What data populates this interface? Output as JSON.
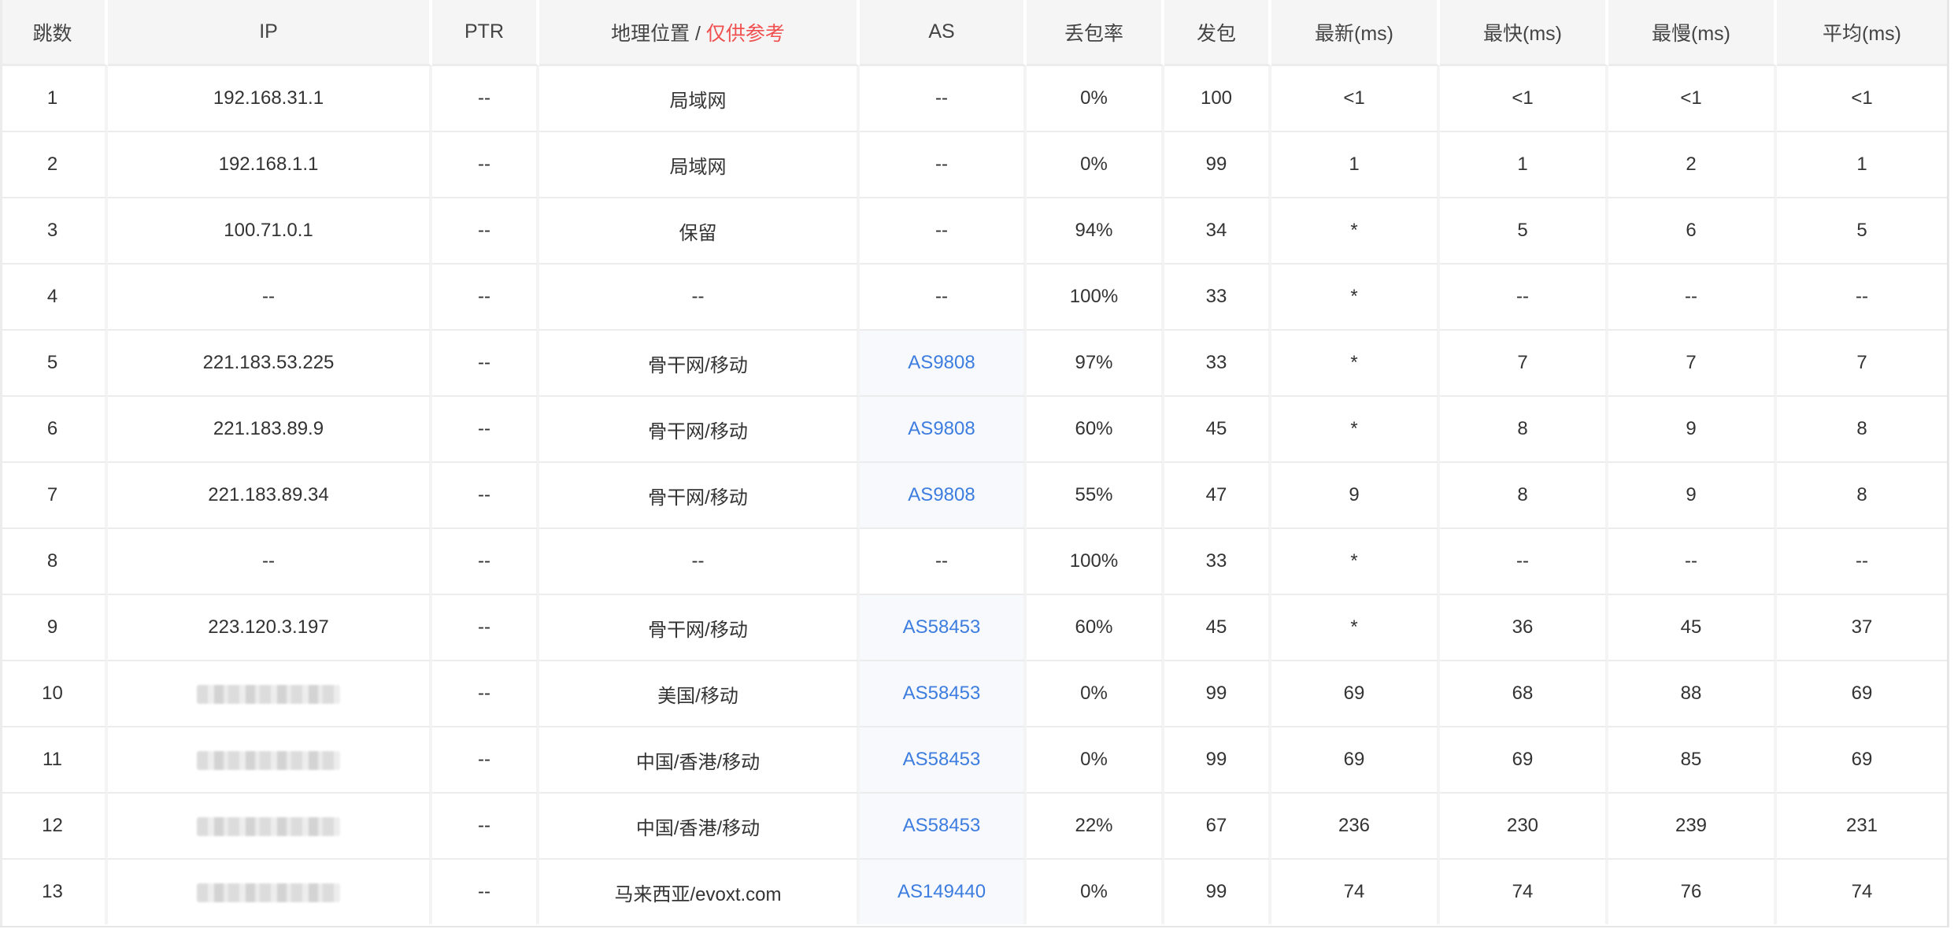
{
  "table": {
    "headers": {
      "hop": "跳数",
      "ip": "IP",
      "ptr": "PTR",
      "geo": "地理位置",
      "geo_sep": " / ",
      "geo_note": "仅供参考",
      "as": "AS",
      "loss": "丢包率",
      "sent": "发包",
      "last": "最新(ms)",
      "best": "最快(ms)",
      "worst": "最慢(ms)",
      "avg": "平均(ms)"
    },
    "colors": {
      "geo_note": "#f05050",
      "as_link": "#3d7de0"
    },
    "rows": [
      {
        "hop": "1",
        "ip": "192.168.31.1",
        "ip_masked": false,
        "ptr": "--",
        "geo": "局域网",
        "as": "--",
        "as_link": false,
        "loss": "0%",
        "sent": "100",
        "last": "<1",
        "best": "<1",
        "worst": "<1",
        "avg": "<1"
      },
      {
        "hop": "2",
        "ip": "192.168.1.1",
        "ip_masked": false,
        "ptr": "--",
        "geo": "局域网",
        "as": "--",
        "as_link": false,
        "loss": "0%",
        "sent": "99",
        "last": "1",
        "best": "1",
        "worst": "2",
        "avg": "1"
      },
      {
        "hop": "3",
        "ip": "100.71.0.1",
        "ip_masked": false,
        "ptr": "--",
        "geo": "保留",
        "as": "--",
        "as_link": false,
        "loss": "94%",
        "sent": "34",
        "last": "*",
        "best": "5",
        "worst": "6",
        "avg": "5"
      },
      {
        "hop": "4",
        "ip": "--",
        "ip_masked": false,
        "ptr": "--",
        "geo": "--",
        "as": "--",
        "as_link": false,
        "loss": "100%",
        "sent": "33",
        "last": "*",
        "best": "--",
        "worst": "--",
        "avg": "--"
      },
      {
        "hop": "5",
        "ip": "221.183.53.225",
        "ip_masked": false,
        "ptr": "--",
        "geo": "骨干网/移动",
        "as": "AS9808",
        "as_link": true,
        "loss": "97%",
        "sent": "33",
        "last": "*",
        "best": "7",
        "worst": "7",
        "avg": "7"
      },
      {
        "hop": "6",
        "ip": "221.183.89.9",
        "ip_masked": false,
        "ptr": "--",
        "geo": "骨干网/移动",
        "as": "AS9808",
        "as_link": true,
        "loss": "60%",
        "sent": "45",
        "last": "*",
        "best": "8",
        "worst": "9",
        "avg": "8"
      },
      {
        "hop": "7",
        "ip": "221.183.89.34",
        "ip_masked": false,
        "ptr": "--",
        "geo": "骨干网/移动",
        "as": "AS9808",
        "as_link": true,
        "loss": "55%",
        "sent": "47",
        "last": "9",
        "best": "8",
        "worst": "9",
        "avg": "8"
      },
      {
        "hop": "8",
        "ip": "--",
        "ip_masked": false,
        "ptr": "--",
        "geo": "--",
        "as": "--",
        "as_link": false,
        "loss": "100%",
        "sent": "33",
        "last": "*",
        "best": "--",
        "worst": "--",
        "avg": "--"
      },
      {
        "hop": "9",
        "ip": "223.120.3.197",
        "ip_masked": false,
        "ptr": "--",
        "geo": "骨干网/移动",
        "as": "AS58453",
        "as_link": true,
        "loss": "60%",
        "sent": "45",
        "last": "*",
        "best": "36",
        "worst": "45",
        "avg": "37"
      },
      {
        "hop": "10",
        "ip": "",
        "ip_masked": true,
        "ptr": "--",
        "geo": "美国/移动",
        "as": "AS58453",
        "as_link": true,
        "loss": "0%",
        "sent": "99",
        "last": "69",
        "best": "68",
        "worst": "88",
        "avg": "69"
      },
      {
        "hop": "11",
        "ip": "",
        "ip_masked": true,
        "ptr": "--",
        "geo": "中国/香港/移动",
        "as": "AS58453",
        "as_link": true,
        "loss": "0%",
        "sent": "99",
        "last": "69",
        "best": "69",
        "worst": "85",
        "avg": "69"
      },
      {
        "hop": "12",
        "ip": "",
        "ip_masked": true,
        "ptr": "--",
        "geo": "中国/香港/移动",
        "as": "AS58453",
        "as_link": true,
        "loss": "22%",
        "sent": "67",
        "last": "236",
        "best": "230",
        "worst": "239",
        "avg": "231"
      },
      {
        "hop": "13",
        "ip": "",
        "ip_masked": true,
        "ptr": "--",
        "geo": "马来西亚/evoxt.com",
        "as": "AS149440",
        "as_link": true,
        "loss": "0%",
        "sent": "99",
        "last": "74",
        "best": "74",
        "worst": "76",
        "avg": "74"
      }
    ]
  }
}
